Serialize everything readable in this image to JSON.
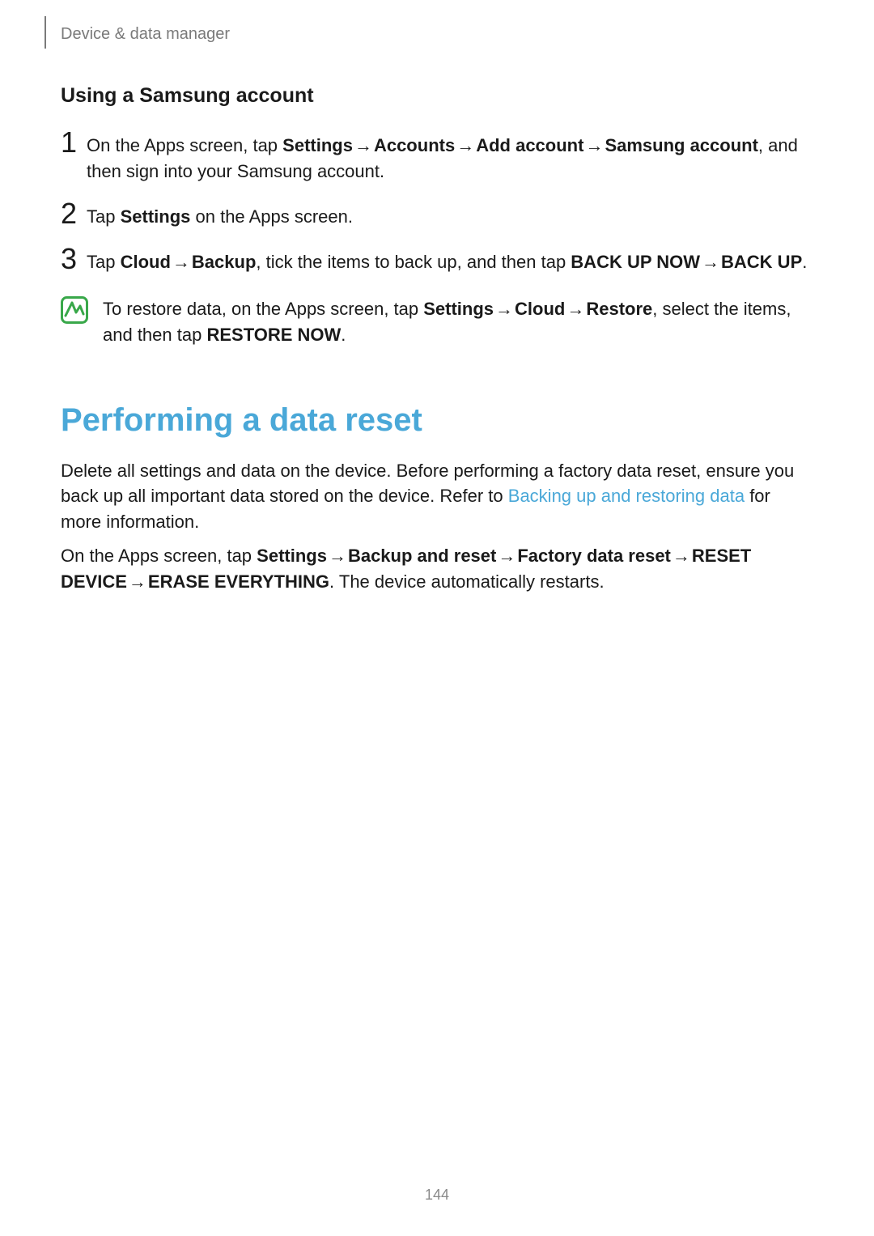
{
  "header": {
    "section_label": "Device & data manager"
  },
  "arrow": "→",
  "subheading": "Using a Samsung account",
  "steps": [
    {
      "num": "1",
      "pre1": "On the Apps screen, tap ",
      "b1": "Settings",
      "b2": "Accounts",
      "b3": "Add account",
      "b4": "Samsung account",
      "post": ", and then sign into your Samsung account."
    },
    {
      "num": "2",
      "pre1": "Tap ",
      "b1": "Settings",
      "post": " on the Apps screen."
    },
    {
      "num": "3",
      "pre1": "Tap ",
      "b1": "Cloud",
      "b2": "Backup",
      "mid": ", tick the items to back up, and then tap ",
      "b3": "BACK UP NOW",
      "b4": "BACK UP",
      "post": "."
    }
  ],
  "note": {
    "pre1": "To restore data, on the Apps screen, tap ",
    "b1": "Settings",
    "b2": "Cloud",
    "b3": "Restore",
    "mid": ", select the items, and then tap ",
    "b4": "RESTORE NOW",
    "post": "."
  },
  "section2": {
    "heading": "Performing a data reset",
    "para1_pre": "Delete all settings and data on the device. Before performing a factory data reset, ensure you back up all important data stored on the device. Refer to ",
    "para1_link": "Backing up and restoring data",
    "para1_post": " for more information.",
    "para2_pre": "On the Apps screen, tap ",
    "b1": "Settings",
    "b2": "Backup and reset",
    "b3": "Factory data reset",
    "b4": "RESET DEVICE",
    "b5": "ERASE EVERYTHING",
    "para2_post": ". The device automatically restarts."
  },
  "page_number": "144"
}
